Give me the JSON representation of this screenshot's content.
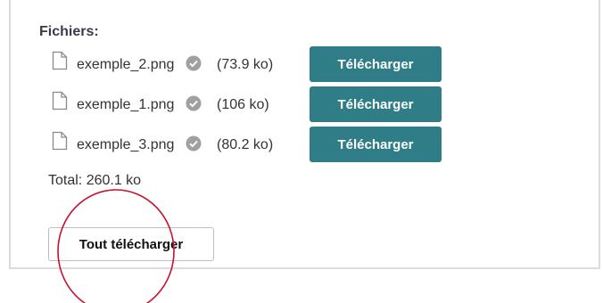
{
  "files_section": {
    "heading": "Fichiers:",
    "files": [
      {
        "name": "exemple_2.png",
        "size": "(73.9 ko)",
        "download_label": "Télécharger",
        "icon": "file-icon",
        "status_icon": "check-circle-icon"
      },
      {
        "name": "exemple_1.png",
        "size": "(106 ko)",
        "download_label": "Télécharger",
        "icon": "file-icon",
        "status_icon": "check-circle-icon"
      },
      {
        "name": "exemple_3.png",
        "size": "(80.2 ko)",
        "download_label": "Télécharger",
        "icon": "file-icon",
        "status_icon": "check-circle-icon"
      }
    ],
    "total": "Total: 260.1 ko",
    "download_all_label": "Tout télécharger"
  },
  "colors": {
    "button_bg": "#2f7d86",
    "button_text": "#ffffff",
    "annotation_circle": "#c8102e",
    "check_icon": "#a0a0a0"
  }
}
